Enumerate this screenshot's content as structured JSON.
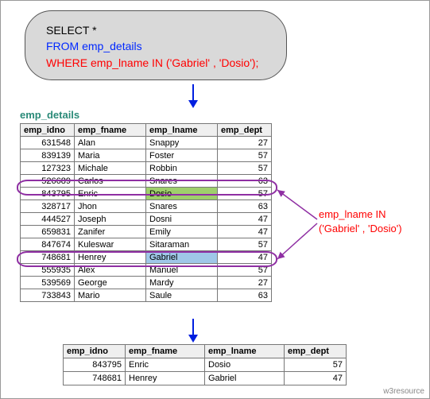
{
  "sql": {
    "line1": "SELECT *",
    "line2": "FROM emp_details",
    "line3": "WHERE emp_lname IN ('Gabriel' , 'Dosio');"
  },
  "table": {
    "title": "emp_details",
    "headers": {
      "idno": "emp_idno",
      "fname": "emp_fname",
      "lname": "emp_lname",
      "dept": "emp_dept"
    }
  },
  "rows": [
    {
      "idno": "631548",
      "fname": "Alan",
      "lname": "Snappy",
      "dept": "27"
    },
    {
      "idno": "839139",
      "fname": "Maria",
      "lname": "Foster",
      "dept": "57"
    },
    {
      "idno": "127323",
      "fname": "Michale",
      "lname": "Robbin",
      "dept": "57"
    },
    {
      "idno": "526689",
      "fname": "Carlos",
      "lname": "Snares",
      "dept": "63"
    },
    {
      "idno": "843795",
      "fname": "Enric",
      "lname": "Dosio",
      "dept": "57"
    },
    {
      "idno": "328717",
      "fname": "Jhon",
      "lname": "Snares",
      "dept": "63"
    },
    {
      "idno": "444527",
      "fname": "Joseph",
      "lname": "Dosni",
      "dept": "47"
    },
    {
      "idno": "659831",
      "fname": "Zanifer",
      "lname": "Emily",
      "dept": "47"
    },
    {
      "idno": "847674",
      "fname": "Kuleswar",
      "lname": "Sitaraman",
      "dept": "57"
    },
    {
      "idno": "748681",
      "fname": "Henrey",
      "lname": "Gabriel",
      "dept": "47"
    },
    {
      "idno": "555935",
      "fname": "Alex",
      "lname": "Manuel",
      "dept": "57"
    },
    {
      "idno": "539569",
      "fname": "George",
      "lname": "Mardy",
      "dept": "27"
    },
    {
      "idno": "733843",
      "fname": "Mario",
      "lname": "Saule",
      "dept": "63"
    }
  ],
  "callout": {
    "line1": "emp_lname IN",
    "line2": "('Gabriel' , 'Dosio')"
  },
  "result_rows": [
    {
      "idno": "843795",
      "fname": "Enric",
      "lname": "Dosio",
      "dept": "57"
    },
    {
      "idno": "748681",
      "fname": "Henrey",
      "lname": "Gabriel",
      "dept": "47"
    }
  ],
  "watermark": "w3resource"
}
